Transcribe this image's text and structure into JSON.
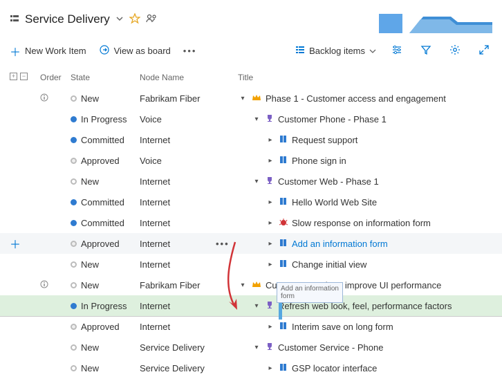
{
  "header": {
    "title": "Service Delivery"
  },
  "toolbar": {
    "new_item": "New Work Item",
    "view_board": "View as board",
    "backlog_items": "Backlog items"
  },
  "columns": {
    "order": "Order",
    "state": "State",
    "node": "Node Name",
    "title": "Title"
  },
  "states": {
    "new": "New",
    "inprog": "In Progress",
    "committed": "Committed",
    "approved": "Approved"
  },
  "nodes": {
    "fabrikam": "Fabrikam Fiber",
    "voice": "Voice",
    "internet": "Internet",
    "service": "Service Delivery"
  },
  "titles": {
    "phase1": "Phase 1 - Customer access and engagement",
    "custphone": "Customer Phone - Phase 1",
    "reqsupport": "Request support",
    "phonesign": "Phone sign in",
    "custweb": "Customer Web - Phase 1",
    "hello": "Hello World Web Site",
    "slowresp": "Slow response on information form",
    "addinfo": "Add an information form",
    "changeview": "Change initial view",
    "custservice": "Customer Service - improve UI performance",
    "refresh": "Refresh web look, feel, performance factors",
    "interim": "Interim save on long form",
    "csphone": "Customer Service - Phone",
    "gsp": "GSP locator interface"
  },
  "tooltip": "Add an information form"
}
